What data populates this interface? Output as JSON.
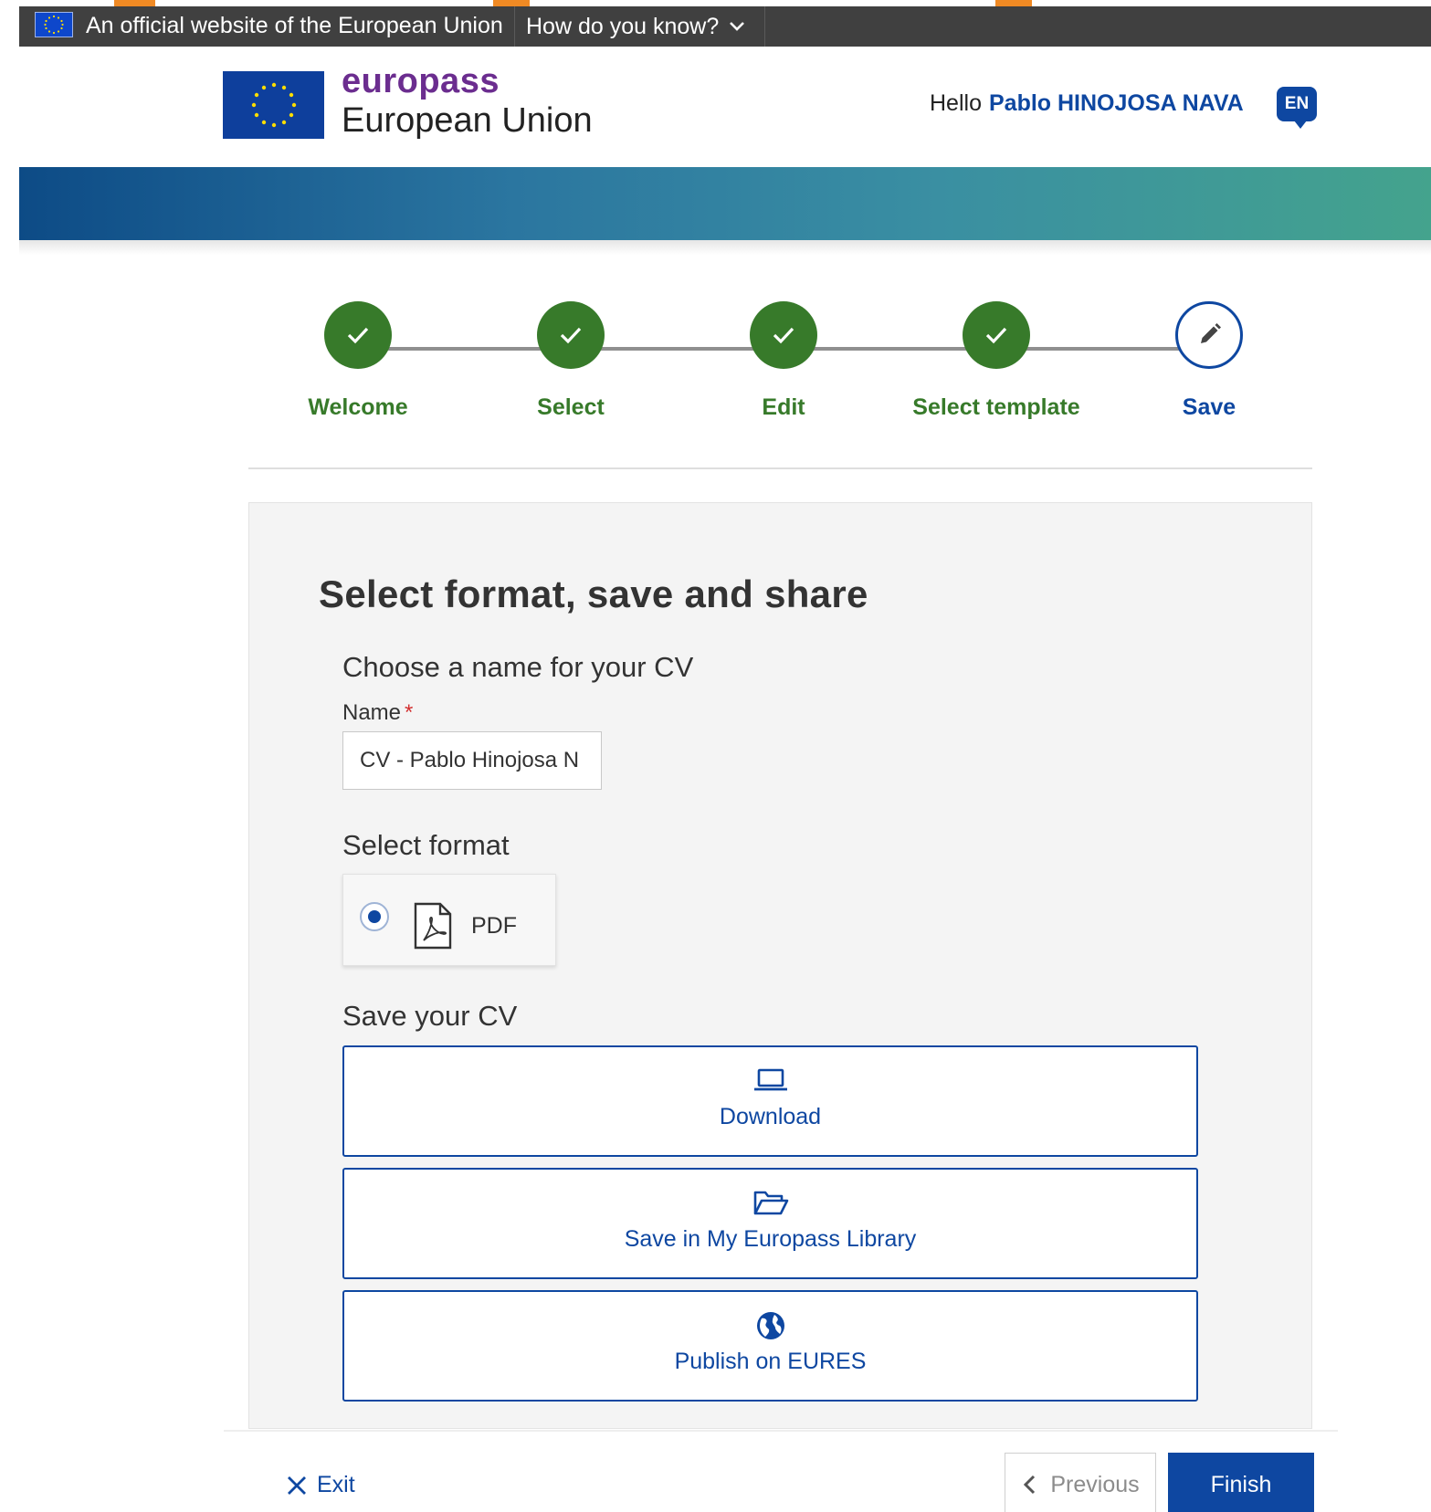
{
  "eu_bar": {
    "official_text": "An official website of the European Union",
    "how_know_label": "How do you know?"
  },
  "header": {
    "brand_name": "europass",
    "brand_sub": "European Union",
    "greeting": "Hello",
    "user_name": "Pablo HINOJOSA NAVA",
    "language": "EN"
  },
  "stepper": {
    "steps": [
      {
        "label": "Welcome",
        "state": "done"
      },
      {
        "label": "Select",
        "state": "done"
      },
      {
        "label": "Edit",
        "state": "done"
      },
      {
        "label": "Select template",
        "state": "done"
      },
      {
        "label": "Save",
        "state": "current"
      }
    ]
  },
  "main": {
    "title": "Select format, save and share",
    "name_section": {
      "heading": "Choose a name for your CV",
      "field_label": "Name",
      "required_mark": "*",
      "value": "CV - Pablo Hinojosa N"
    },
    "format_section": {
      "heading": "Select format",
      "options": [
        {
          "label": "PDF",
          "selected": true
        }
      ]
    },
    "save_section": {
      "heading": "Save your CV",
      "actions": [
        {
          "label": "Download",
          "icon": "laptop-icon"
        },
        {
          "label": "Save in My Europass Library",
          "icon": "folder-open-icon"
        },
        {
          "label": "Publish on EURES",
          "icon": "globe-icon"
        }
      ]
    }
  },
  "footer": {
    "exit_label": "Exit",
    "previous_label": "Previous",
    "finish_label": "Finish"
  },
  "colors": {
    "primary_blue": "#0e47a1",
    "done_green": "#377a2a",
    "brand_purple": "#6b2d8f",
    "eu_bar_gray": "#404040",
    "accent_orange": "#f08a24"
  }
}
